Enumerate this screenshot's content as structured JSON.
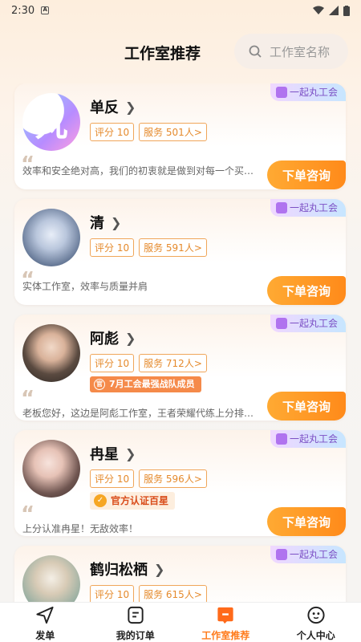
{
  "status": {
    "time": "2:30"
  },
  "header": {
    "title": "工作室推荐",
    "search_placeholder": "工作室名称"
  },
  "studios": [
    {
      "name": "单反",
      "rating": "评分 10",
      "service": "服务 501人>",
      "union": "一起丸工会",
      "desc": "效率和安全绝对高，我们的初衷就是做到对每一个买…",
      "button": "下单咨询"
    },
    {
      "name": "清",
      "rating": "评分 10",
      "service": "服务 591人>",
      "union": "一起丸工会",
      "desc": "实体工作室，效率与质量并肩",
      "button": "下单咨询"
    },
    {
      "name": "阿彪",
      "rating": "评分 10",
      "service": "服务 712人>",
      "union": "一起丸工会",
      "badge": "7月工会最强战队成员",
      "desc": "老板您好，这边是阿彪工作室，王者荣耀代练上分排…",
      "button": "下单咨询"
    },
    {
      "name": "冉星",
      "rating": "评分 10",
      "service": "服务 596人>",
      "union": "一起丸工会",
      "badge": "官方认证百星",
      "desc": "上分认准冉星！无敌效率！",
      "button": "下单咨询"
    },
    {
      "name": "鹤归松栖",
      "rating": "评分 10",
      "service": "服务 615人>",
      "union": "一起丸工会"
    }
  ],
  "tabbar": [
    {
      "label": "发单",
      "icon": "send-icon"
    },
    {
      "label": "我的订单",
      "icon": "orders-icon"
    },
    {
      "label": "工作室推荐",
      "icon": "studio-icon"
    },
    {
      "label": "个人中心",
      "icon": "profile-icon"
    }
  ],
  "colors": {
    "accent": "#ff8a1a",
    "chip": "#e58a2c",
    "union": "#7b4fc4"
  }
}
